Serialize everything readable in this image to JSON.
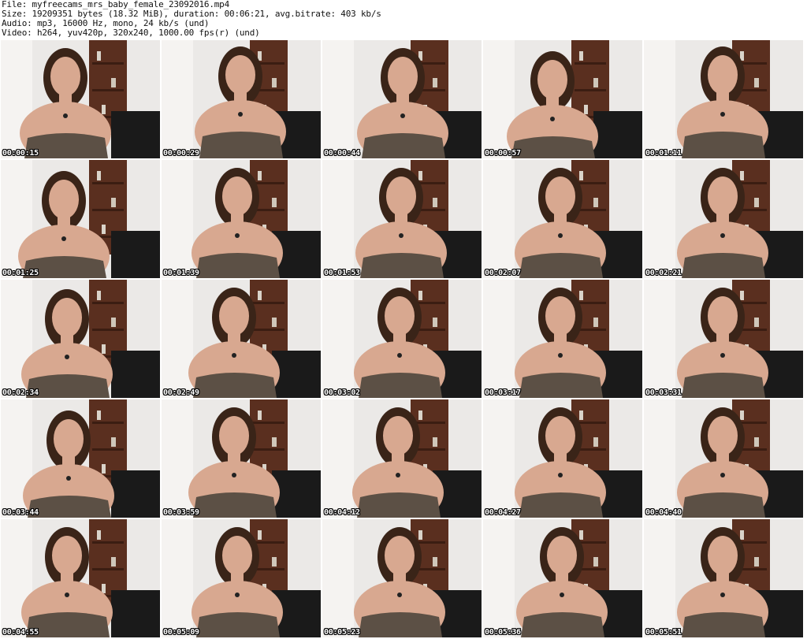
{
  "header": {
    "file_line": "File: myfreecams_mrs_baby_female_23092016.mp4",
    "size_line": "Size: 19209351 bytes (18.32 MiB), duration: 00:06:21, avg.bitrate: 403 kb/s",
    "audio_line": "Audio: mp3, 16000 Hz, mono, 24 kb/s (und)",
    "video_line": "Video: h264, yuv420p, 320x240, 1000.00 fps(r) (und)"
  },
  "thumbnails": [
    {
      "time": "00:00:15",
      "icon": "video-frame-thumbnail"
    },
    {
      "time": "00:00:29",
      "icon": "video-frame-thumbnail"
    },
    {
      "time": "00:00:44",
      "icon": "video-frame-thumbnail"
    },
    {
      "time": "00:00:57",
      "icon": "video-frame-thumbnail"
    },
    {
      "time": "00:01:11",
      "icon": "video-frame-thumbnail"
    },
    {
      "time": "00:01:25",
      "icon": "video-frame-thumbnail"
    },
    {
      "time": "00:01:39",
      "icon": "video-frame-thumbnail"
    },
    {
      "time": "00:01:53",
      "icon": "video-frame-thumbnail"
    },
    {
      "time": "00:02:07",
      "icon": "video-frame-thumbnail"
    },
    {
      "time": "00:02:21",
      "icon": "video-frame-thumbnail"
    },
    {
      "time": "00:02:34",
      "icon": "video-frame-thumbnail"
    },
    {
      "time": "00:02:49",
      "icon": "video-frame-thumbnail"
    },
    {
      "time": "00:03:02",
      "icon": "video-frame-thumbnail"
    },
    {
      "time": "00:03:17",
      "icon": "video-frame-thumbnail"
    },
    {
      "time": "00:03:31",
      "icon": "video-frame-thumbnail"
    },
    {
      "time": "00:03:44",
      "icon": "video-frame-thumbnail"
    },
    {
      "time": "00:03:59",
      "icon": "video-frame-thumbnail"
    },
    {
      "time": "00:04:12",
      "icon": "video-frame-thumbnail"
    },
    {
      "time": "00:04:27",
      "icon": "video-frame-thumbnail"
    },
    {
      "time": "00:04:40",
      "icon": "video-frame-thumbnail"
    },
    {
      "time": "00:04:55",
      "icon": "video-frame-thumbnail"
    },
    {
      "time": "00:05:09",
      "icon": "video-frame-thumbnail"
    },
    {
      "time": "00:05:23",
      "icon": "video-frame-thumbnail"
    },
    {
      "time": "00:05:36",
      "icon": "video-frame-thumbnail"
    },
    {
      "time": "00:05:51",
      "icon": "video-frame-thumbnail"
    }
  ],
  "colors": {
    "background": "#ffffff",
    "wall": "#ebe9e7",
    "shelf": "#5a2f1f",
    "hair": "#3a2418",
    "skin": "#d8a890",
    "dress": "#5c5045",
    "timestamp": "#ffffff"
  }
}
